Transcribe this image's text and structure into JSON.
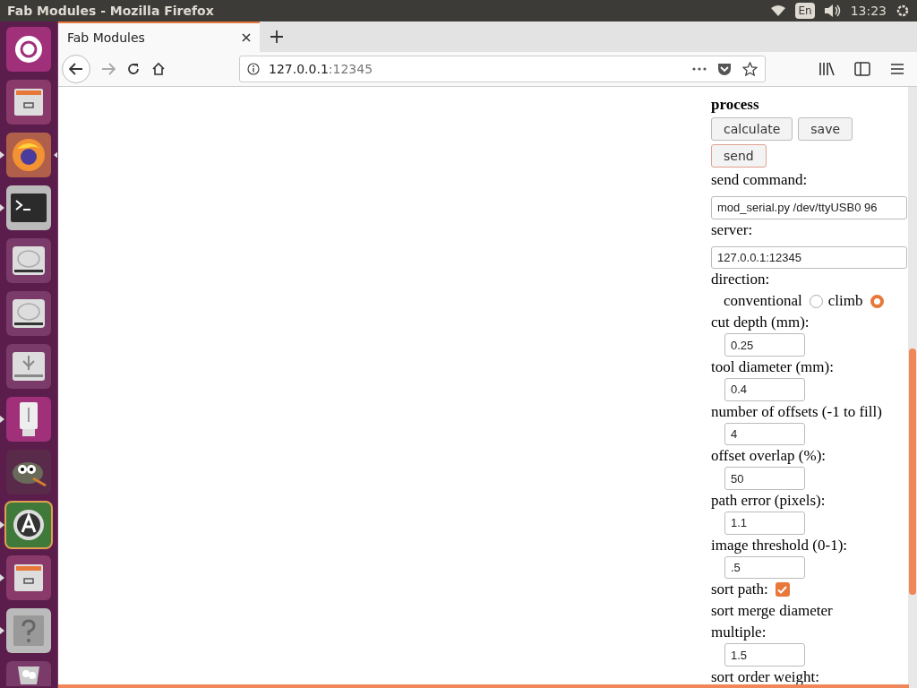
{
  "top_bar": {
    "title": "Fab Modules - Mozilla Firefox",
    "keyboard": "En",
    "time": "13:23"
  },
  "launcher": [
    {
      "kind": "dash",
      "running": false,
      "focused": false
    },
    {
      "kind": "files",
      "running": false,
      "focused": false
    },
    {
      "kind": "browser",
      "running": true,
      "focused": true
    },
    {
      "kind": "terminal",
      "running": true,
      "focused": false
    },
    {
      "kind": "disk",
      "running": false,
      "focused": false
    },
    {
      "kind": "disk",
      "running": false,
      "focused": false
    },
    {
      "kind": "drive",
      "running": false,
      "focused": false
    },
    {
      "kind": "usb",
      "running": true,
      "focused": false
    },
    {
      "kind": "gimp",
      "running": false,
      "focused": false
    },
    {
      "kind": "updater",
      "running": true,
      "focused": false
    },
    {
      "kind": "files",
      "running": true,
      "focused": false
    },
    {
      "kind": "help",
      "running": true,
      "focused": false
    },
    {
      "kind": "trash",
      "running": false,
      "focused": false
    }
  ],
  "tab": {
    "title": "Fab Modules"
  },
  "url": {
    "host": "127.0.0.1",
    "port": ":12345"
  },
  "page": [
    {
      "kind": "heading",
      "text": "process"
    },
    {
      "kind": "buttons",
      "buttons": [
        {
          "label": "calculate",
          "focused": false
        },
        {
          "label": "save",
          "focused": false
        }
      ]
    },
    {
      "kind": "buttons",
      "buttons": [
        {
          "label": "send",
          "focused": true
        }
      ]
    },
    {
      "kind": "label",
      "text": "send command:"
    },
    {
      "kind": "wide-input",
      "value": "mod_serial.py /dev/ttyUSB0 96"
    },
    {
      "kind": "label",
      "text": "server:"
    },
    {
      "kind": "wide-input",
      "value": "127.0.0.1:12345"
    },
    {
      "kind": "label",
      "text": "direction:"
    },
    {
      "kind": "radios",
      "options": [
        {
          "label": "conventional",
          "selected": false
        },
        {
          "label": "climb",
          "selected": true
        }
      ]
    },
    {
      "kind": "label",
      "text": "cut depth (mm):"
    },
    {
      "kind": "input",
      "value": "0.25"
    },
    {
      "kind": "label",
      "text": "tool diameter (mm):"
    },
    {
      "kind": "input",
      "value": "0.4"
    },
    {
      "kind": "label",
      "text": "number of offsets (-1 to fill)"
    },
    {
      "kind": "input",
      "value": "4"
    },
    {
      "kind": "label",
      "text": "offset overlap (%):"
    },
    {
      "kind": "input",
      "value": "50"
    },
    {
      "kind": "label",
      "text": "path error (pixels):"
    },
    {
      "kind": "input",
      "value": "1.1"
    },
    {
      "kind": "label",
      "text": "image threshold (0-1):"
    },
    {
      "kind": "input",
      "value": ".5"
    },
    {
      "kind": "checkbox",
      "text": "sort path:",
      "checked": true
    },
    {
      "kind": "label",
      "text": "sort merge diameter multiple:"
    },
    {
      "kind": "input",
      "value": "1.5"
    },
    {
      "kind": "label",
      "text": "sort order weight:"
    }
  ]
}
